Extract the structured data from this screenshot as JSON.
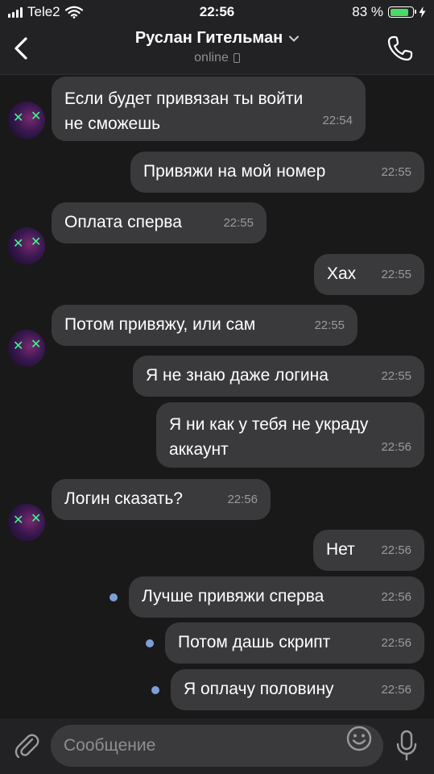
{
  "status_bar": {
    "carrier": "Tele2",
    "time": "22:56",
    "battery_percent": "83 %",
    "battery_level": 0.83
  },
  "header": {
    "contact_name": "Руслан Гительман",
    "status": "online"
  },
  "messages": [
    {
      "dir": "in",
      "text": "Если будет привязан ты войти\nне сможешь",
      "time": "22:54",
      "avatar": true
    },
    {
      "dir": "out",
      "text": "Привяжи на мой номер",
      "time": "22:55"
    },
    {
      "dir": "in",
      "text": "Оплата сперва",
      "time": "22:55",
      "avatar": true
    },
    {
      "dir": "out",
      "text": "Хах",
      "time": "22:55"
    },
    {
      "dir": "in",
      "text": "Потом привяжу, или сам",
      "time": "22:55",
      "avatar": true
    },
    {
      "dir": "out",
      "text": "Я не знаю даже логина",
      "time": "22:55"
    },
    {
      "dir": "out",
      "text": "Я ни как у тебя не украду\nаккаунт",
      "time": "22:56"
    },
    {
      "dir": "in",
      "text": "Логин сказать?",
      "time": "22:56",
      "avatar": true
    },
    {
      "dir": "out",
      "text": "Нет",
      "time": "22:56"
    },
    {
      "dir": "out",
      "text": "Лучше привяжи сперва",
      "time": "22:56",
      "unread": true
    },
    {
      "dir": "out",
      "text": "Потом дашь скрипт",
      "time": "22:56",
      "unread": true
    },
    {
      "dir": "out",
      "text": "Я оплачу половину",
      "time": "22:56",
      "unread": true
    }
  ],
  "input": {
    "placeholder": "Сообщение"
  },
  "colors": {
    "background": "#19191a",
    "bubble": "#3a3a3c",
    "unread_dot": "#7e9fd6",
    "battery": "#4cd964"
  },
  "icons": [
    "back-arrow-icon",
    "chevron-down-icon",
    "phone-icon",
    "paperclip-icon",
    "emoji-icon",
    "microphone-icon",
    "wifi-icon",
    "signal-icon",
    "battery-icon",
    "charging-icon"
  ]
}
